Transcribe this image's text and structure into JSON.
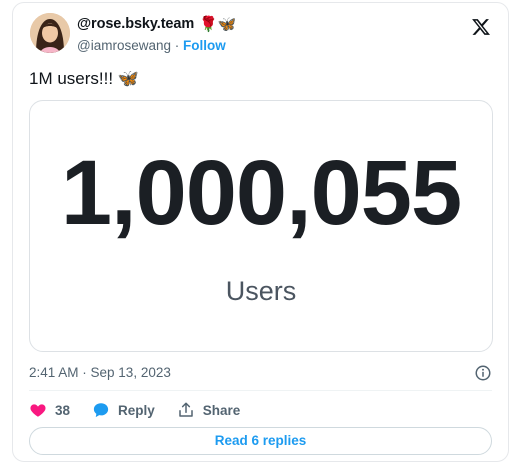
{
  "author": {
    "display_name": "@rose.bsky.team",
    "name_emojis": "🌹🦋",
    "handle": "@iamrosewang",
    "separator": " · ",
    "follow_label": "Follow"
  },
  "tweet": {
    "text": "1M users!!! 🦋",
    "embed": {
      "number": "1,000,055",
      "label": "Users"
    },
    "timestamp": "2:41 AM · Sep 13, 2023"
  },
  "actions": {
    "like_count": "38",
    "reply_label": "Reply",
    "share_label": "Share",
    "read_replies_label": "Read 6 replies"
  },
  "colors": {
    "accent": "#1d9bf0",
    "like": "#f91880",
    "muted_text": "#536471"
  },
  "icons": [
    "x-logo-icon",
    "info-icon",
    "heart-icon",
    "reply-bubble-icon",
    "share-icon"
  ]
}
